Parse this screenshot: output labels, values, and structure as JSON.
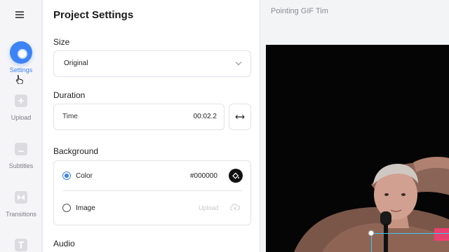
{
  "sidebar": {
    "items": [
      {
        "label": "Settings",
        "icon": "gear-icon",
        "active": true
      },
      {
        "label": "Upload",
        "icon": "plus-icon"
      },
      {
        "label": "Subtitles",
        "icon": "subtitles-icon"
      },
      {
        "label": "Transitions",
        "icon": "transitions-icon"
      },
      {
        "label": "",
        "icon": "text-icon"
      }
    ]
  },
  "settings": {
    "title": "Project Settings",
    "size": {
      "label": "Size",
      "value": "Original"
    },
    "duration": {
      "label": "Duration",
      "time_label": "Time",
      "time_value": "00:02.2"
    },
    "background": {
      "label": "Background",
      "color_option": "Color",
      "color_value": "#000000",
      "image_option": "Image",
      "upload_label": "Upload"
    },
    "audio": {
      "label": "Audio"
    }
  },
  "preview": {
    "title": "Pointing GIF Tim"
  },
  "colors": {
    "accent": "#3d83f5",
    "selection": "#3ec5f0",
    "canvas_bg": "#000000"
  }
}
